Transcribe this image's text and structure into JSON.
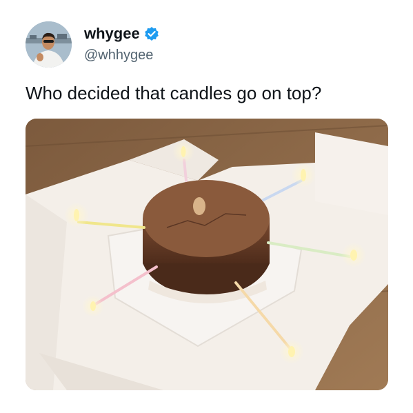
{
  "tweet": {
    "author": {
      "display_name": "whygee",
      "handle": "@whhygee",
      "verified": true,
      "verified_color": "#1d9bf0"
    },
    "text": "Who decided that candles go on top?",
    "media": {
      "icon": "photo"
    }
  },
  "colors": {
    "text_primary": "#0f1419",
    "text_secondary": "#536471",
    "background": "#ffffff"
  }
}
